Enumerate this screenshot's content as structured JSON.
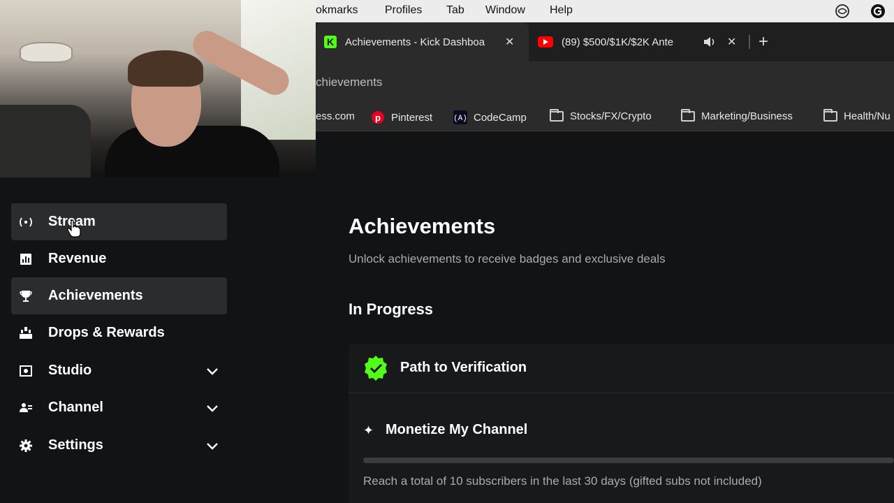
{
  "menubar": {
    "items": [
      "okmarks",
      "Profiles",
      "Tab",
      "Window",
      "Help"
    ]
  },
  "tabs": [
    {
      "title": "Achievements - Kick Dashboa",
      "favicon": "K",
      "favicon_color": "#53fc18",
      "active": true
    },
    {
      "title": "(89) $500/$1K/$2K Ante",
      "favicon": "youtube-icon",
      "favicon_color": "#ff0000",
      "active": false
    }
  ],
  "address": {
    "text": "chievements"
  },
  "bookmarks": [
    {
      "label": "ess.com",
      "icon": "none"
    },
    {
      "label": "Pinterest",
      "icon": "pinterest-icon"
    },
    {
      "label": "CodeCamp",
      "icon": "freecodecamp-icon"
    },
    {
      "label": "Stocks/FX/Crypto",
      "icon": "folder-icon"
    },
    {
      "label": "Marketing/Business",
      "icon": "folder-icon"
    },
    {
      "label": "Health/Nu",
      "icon": "folder-icon"
    }
  ],
  "sidebar": {
    "items": [
      {
        "label": "Stream",
        "icon": "broadcast-icon",
        "expandable": false
      },
      {
        "label": "Revenue",
        "icon": "bar-chart-icon",
        "expandable": false
      },
      {
        "label": "Achievements",
        "icon": "trophy-icon",
        "expandable": false,
        "selected": true
      },
      {
        "label": "Drops & Rewards",
        "icon": "drops-icon",
        "expandable": false
      },
      {
        "label": "Studio",
        "icon": "camera-icon",
        "expandable": true
      },
      {
        "label": "Channel",
        "icon": "user-group-icon",
        "expandable": true
      },
      {
        "label": "Settings",
        "icon": "gear-icon",
        "expandable": true
      }
    ]
  },
  "main": {
    "title": "Achievements",
    "subtitle": "Unlock achievements to receive badges and exclusive deals",
    "section": "In Progress",
    "achievement": {
      "title": "Path to Verification",
      "sub_title": "Monetize My Channel",
      "progress": 0,
      "requirement": "Reach a total of 10 subscribers in the last 30 days (gifted subs not included)"
    }
  },
  "colors": {
    "accent": "#53fc18",
    "background": "#121314",
    "highlight": "#2a2c2e"
  }
}
